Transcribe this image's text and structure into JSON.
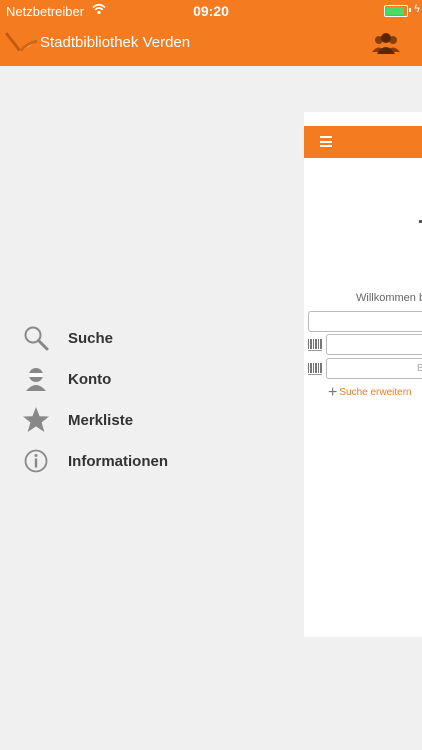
{
  "status_bar": {
    "carrier": "Netzbetreiber",
    "time": "09:20",
    "battery_level": 0.9,
    "wifi_icon": "wifi-icon",
    "charging_icon": "charging-bolt-icon"
  },
  "header": {
    "title": "Stadtbibliothek Verden",
    "logo_icon": "book-logo-icon",
    "account_icon": "users-icon"
  },
  "menu": {
    "items": [
      {
        "label": "Suche",
        "icon": "search-icon"
      },
      {
        "label": "Konto",
        "icon": "person-icon"
      },
      {
        "label": "Merkliste",
        "icon": "star-icon"
      },
      {
        "label": "Informationen",
        "icon": "info-icon"
      }
    ]
  },
  "content": {
    "menu_icon": "hamburger-icon",
    "welcome": "Willkommen be",
    "field3_placeholder": "B",
    "expand_search": "Suche erweitern"
  },
  "colors": {
    "brand": "#f47b20",
    "background": "#f0f0f0",
    "menu_icon": "#888888"
  }
}
